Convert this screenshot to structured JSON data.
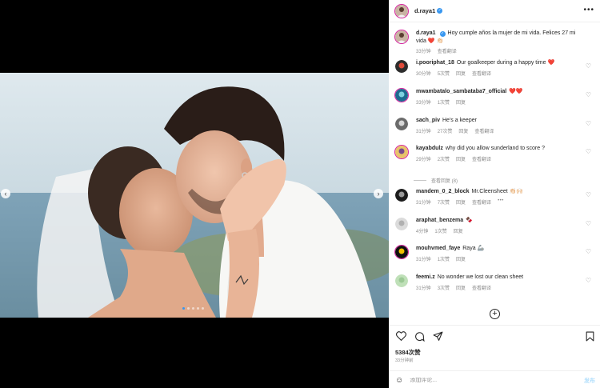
{
  "post": {
    "username": "d.raya1",
    "caption": "Hoy cumple años la mujer de mi vida. Felices 27 mi vida ❤️ 👏🏻",
    "caption_time": "33分钟",
    "caption_translate": "查看翻译",
    "photo_page_count": 5,
    "photo_page_active": 0
  },
  "comments": [
    {
      "user": "i.pooriphat_18",
      "text": "Our goalkeeper during a happy time ❤️",
      "time": "30分钟",
      "likes": "5次赞",
      "reply": "回复",
      "translate": "查看翻译"
    },
    {
      "user": "mwambatalo_sambataba7_official",
      "verified": false,
      "text": "❤️❤️",
      "time": "33分钟",
      "likes": "1次赞",
      "reply": "回复",
      "translate": ""
    },
    {
      "user": "sach_piv",
      "text": "He's a keeper",
      "time": "31分钟",
      "likes": "27次赞",
      "reply": "回复",
      "translate": "查看翻译"
    },
    {
      "user": "kayabdulz",
      "text": "why did you allow sunderland to score ?",
      "time": "29分钟",
      "likes": "2次赞",
      "reply": "回复",
      "translate": "查看翻译"
    },
    {
      "user": "mandem_0_2_block",
      "text": "Mr.Cleensheet 👏🏻🙌🏻",
      "time": "31分钟",
      "likes": "7次赞",
      "reply": "回复",
      "translate": "查看翻译",
      "more": "•••"
    },
    {
      "user": "araphat_benzema",
      "text": "🍫",
      "time": "4分钟",
      "likes": "1次赞",
      "reply": "回复",
      "translate": ""
    },
    {
      "user": "mouhvmed_faye",
      "text": "Raya 🦾",
      "time": "31分钟",
      "likes": "1次赞",
      "reply": "回复",
      "translate": ""
    },
    {
      "user": "feemi.z",
      "text": "No wonder we lost our clean sheet",
      "time": "31分钟",
      "likes": "3次赞",
      "reply": "回复",
      "translate": "查看翻译"
    }
  ],
  "view_replies": "查看回复 (8)",
  "footer": {
    "likes": "5384次赞",
    "time": "33分钟前",
    "comment_placeholder": "添加评论...",
    "post_label": "发布"
  },
  "icons": [
    "heart-icon",
    "comment-icon",
    "share-icon",
    "bookmark-icon",
    "more-icon",
    "emoji-icon",
    "add-circle-icon",
    "chevron-left-icon",
    "chevron-right-icon",
    "verified-icon"
  ],
  "colors": {
    "accent": "#3897f0",
    "like_red": "#ed4956",
    "muted": "#8e8e8e",
    "post_disabled": "#b2dffc"
  }
}
